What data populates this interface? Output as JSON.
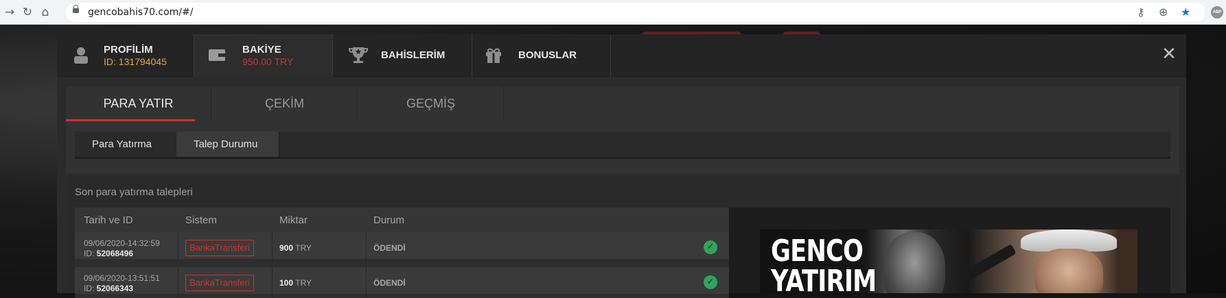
{
  "browser": {
    "url": "gencobahis70.com/#/",
    "back_icon": "arrow-left-icon",
    "reload_icon": "reload-icon",
    "home_icon": "home-icon",
    "key_icon": "key-icon",
    "zoom_icon": "zoom-icon",
    "star_icon": "star-icon",
    "abp_label": "ABP",
    "accent": "#1a73e8"
  },
  "account_tabs": {
    "profile": {
      "title": "PROFİLİM",
      "subtitle": "ID: 131794045",
      "subtitle_color": "#e8a53a"
    },
    "balance": {
      "title": "BAKİYE",
      "subtitle": "950.00 TRY",
      "subtitle_color": "#d0322a"
    },
    "bets": {
      "title": "BAHİSLERİM"
    },
    "bonuses": {
      "title": "BONUSLAR"
    },
    "close_icon": "close-icon"
  },
  "section_tabs": [
    "PARA YATIR",
    "ÇEKİM",
    "GEÇMİŞ"
  ],
  "sub_tabs": [
    "Para Yatırma",
    "Talep Durumu"
  ],
  "deposits": {
    "title": "Son para yatırma talepleri",
    "columns": [
      "Tarih ve ID",
      "Sistem",
      "Miktar",
      "Durum"
    ],
    "rows": [
      {
        "date": "09/06/2020-14:32:59",
        "id_label": "ID: ",
        "id": "52068496",
        "system": "BankaTransferi",
        "amount": "900",
        "currency": "TRY",
        "status": "ÖDENDİ"
      },
      {
        "date": "09/06/2020-13:51:51",
        "id_label": "ID: ",
        "id": "52066343",
        "system": "BankaTransferi",
        "amount": "100",
        "currency": "TRY",
        "status": "ÖDENDİ"
      }
    ],
    "status_color": "#2fa55b"
  },
  "promo": {
    "title_line1": "GENCO",
    "title_line2": "YATIRIM"
  },
  "colors": {
    "brand_red": "#d0322a",
    "id_orange": "#e8a53a"
  }
}
